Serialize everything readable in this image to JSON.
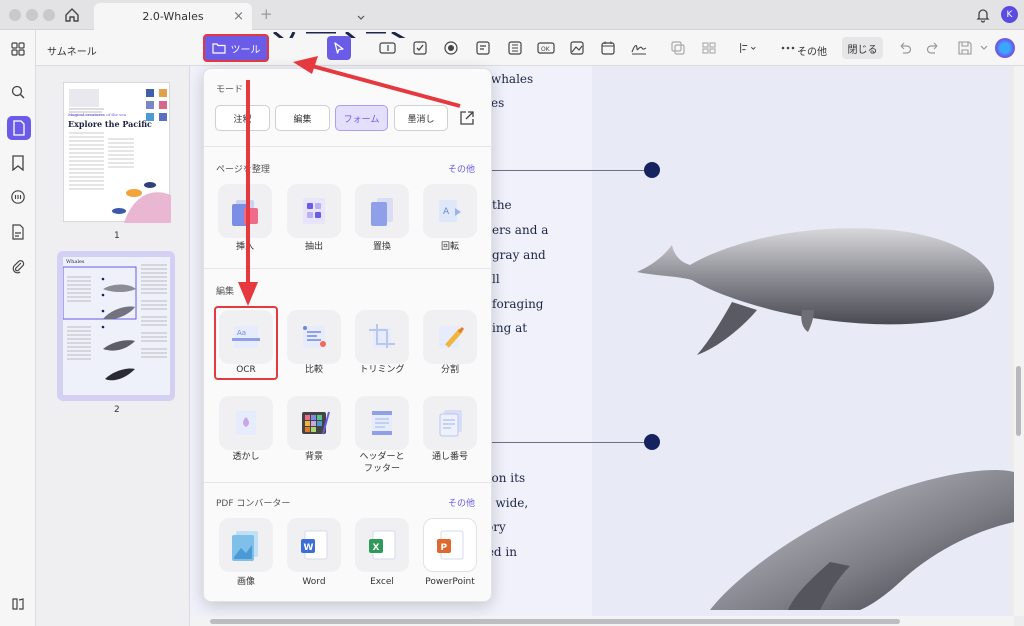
{
  "window": {
    "tab_title": "2.0-Whales",
    "avatar_initial": "K"
  },
  "toolbar": {
    "tools_label": "ツール",
    "more_label": "その他",
    "close_label": "閉じる"
  },
  "sidebar": {
    "panel_title": "サムネール",
    "page1_label": "1",
    "page2_label": "2",
    "thumb1_heading_small": "Magical creatures of the sea",
    "thumb1_heading": "Explore the Pacific",
    "thumb2_title": "Whales"
  },
  "document": {
    "lines_top": [
      "e whales",
      "ales"
    ],
    "lines_mid": [
      "the",
      "ers and a",
      "gray and",
      "ll",
      "foraging",
      "ing at"
    ],
    "lines_bottom": [
      "n on its",
      "d wide,",
      "ory",
      "ted in"
    ]
  },
  "menu": {
    "mode_title": "モード",
    "modes": [
      "注釈",
      "編集",
      "フォーム",
      "墨消し"
    ],
    "active_mode": "フォーム",
    "page_section_title": "ページを整理",
    "page_more": "その他",
    "page_tools": [
      "挿入",
      "抽出",
      "置換",
      "回転"
    ],
    "edit_section_title": "編集",
    "edit_tools_row1": [
      "OCR",
      "比較",
      "トリミング",
      "分割"
    ],
    "edit_tools_row2": [
      "透かし",
      "背景",
      "ヘッダーと\nフッター",
      "通し番号"
    ],
    "converter_title": "PDF コンバーター",
    "converter_more": "その他",
    "converters": [
      "画像",
      "Word",
      "Excel",
      "PowerPoint"
    ]
  },
  "colors": {
    "accent": "#6b5ce7",
    "highlight": "#e5393f",
    "doc_dark": "#17235e"
  }
}
